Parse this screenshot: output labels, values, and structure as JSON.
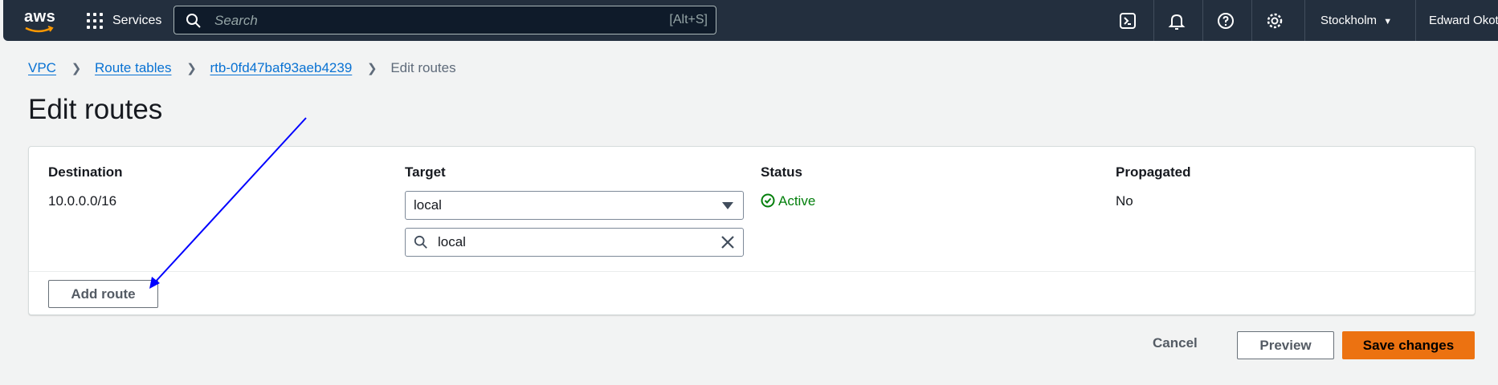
{
  "topbar": {
    "logo": "aws",
    "services_label": "Services",
    "search_placeholder": "Search",
    "search_shortcut": "[Alt+S]",
    "region": "Stockholm",
    "user": "Edward Okot"
  },
  "breadcrumb": {
    "items": [
      "VPC",
      "Route tables",
      "rtb-0fd47baf93aeb4239"
    ],
    "current": "Edit routes"
  },
  "page_title": "Edit routes",
  "routes_table": {
    "headers": {
      "destination": "Destination",
      "target": "Target",
      "status": "Status",
      "propagated": "Propagated"
    },
    "rows": [
      {
        "destination": "10.0.0.0/16",
        "target": "local",
        "target_filter": "local",
        "status": "Active",
        "propagated": "No"
      }
    ]
  },
  "actions": {
    "add_route": "Add route",
    "cancel": "Cancel",
    "preview": "Preview",
    "save": "Save changes"
  },
  "colors": {
    "topbar_bg": "#232f3e",
    "link": "#0972d3",
    "status_active": "#037f0c",
    "primary_button": "#ec7211",
    "annotation_arrow": "#0000ff"
  }
}
